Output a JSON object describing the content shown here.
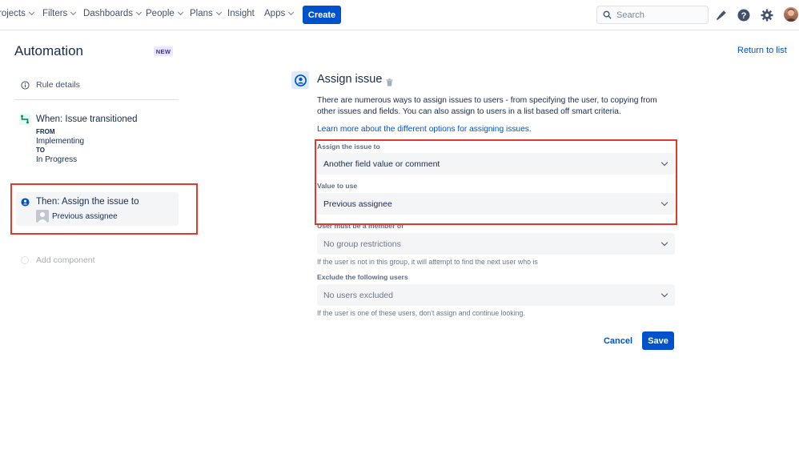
{
  "nav": {
    "items": [
      {
        "label": "rojects"
      },
      {
        "label": "Filters"
      },
      {
        "label": "Dashboards"
      },
      {
        "label": "People"
      },
      {
        "label": "Plans"
      },
      {
        "label": "Insight"
      },
      {
        "label": "Apps"
      }
    ],
    "create_label": "Create",
    "search_placeholder": "Search",
    "icons": [
      "notifications-icon",
      "help-icon",
      "settings-icon",
      "profile-avatar"
    ]
  },
  "sidebar": {
    "title": "Automation",
    "badge": "NEW",
    "rule_details": "Rule details",
    "trigger": {
      "title": "When: Issue transitioned",
      "from_label": "FROM",
      "from_value": "Implementing",
      "to_label": "TO",
      "to_value": "In Progress"
    },
    "action": {
      "title": "Then: Assign the issue to",
      "subtitle": "Previous assignee"
    },
    "add_component": "Add component"
  },
  "main": {
    "return_link": "Return to list",
    "title": "Assign issue",
    "description": "There are numerous ways to assign issues to users - from specifying the user, to copying from other issues and fields. You can also assign to users in a list based off smart criteria.",
    "learn_more": "Learn more about the different options for assigning issues.",
    "fields": {
      "assign_label": "Assign the issue to",
      "assign_value": "Another field value or comment",
      "value_label": "Value to use",
      "value_value": "Previous assignee",
      "member_label": "User must be a member of",
      "member_value": "No group restrictions",
      "member_help": "If the user is not in this group, it will attempt to find the next user who is",
      "exclude_label": "Exclude the following users",
      "exclude_value": "No users excluded",
      "exclude_help": "If the user is one of these users, don't assign and continue looking."
    },
    "cancel_label": "Cancel",
    "save_label": "Save"
  },
  "colors": {
    "primary": "#0052cc",
    "highlight": "#e03a2f",
    "text": "#172b4d",
    "trigger_icon": "#00875a"
  }
}
